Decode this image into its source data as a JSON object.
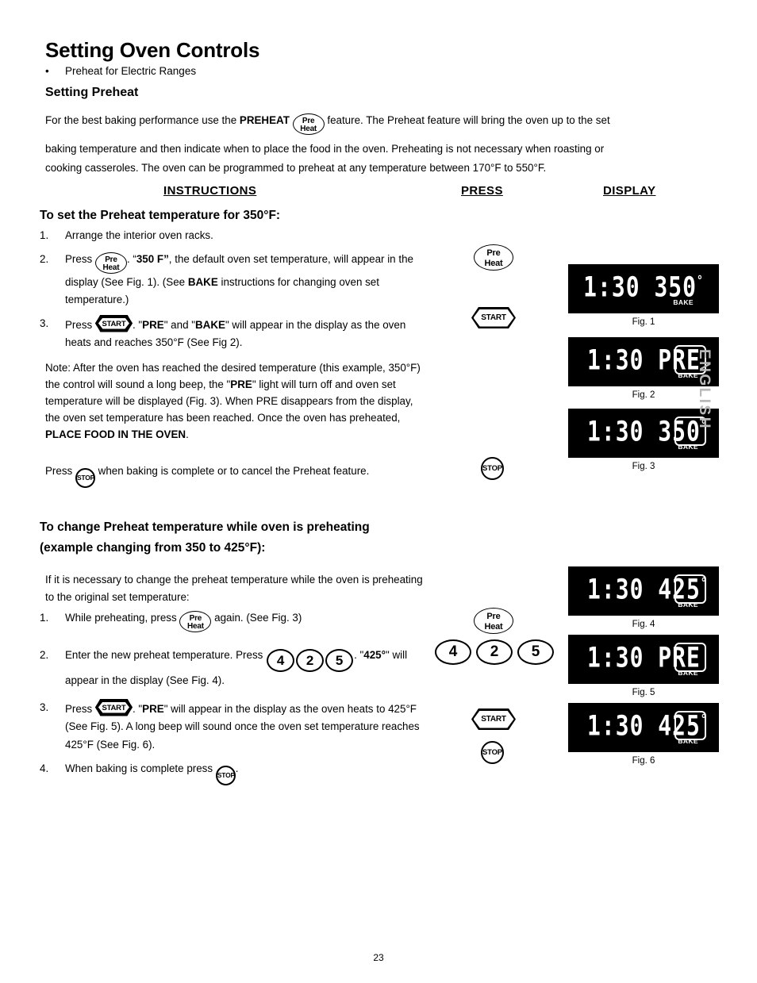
{
  "header": {
    "title": "Setting Oven Controls",
    "bullet": "Preheat for Electric Ranges",
    "subtitle": "Setting Preheat"
  },
  "intro": {
    "line1_a": "For the best baking performance use the ",
    "line1_bold": "PREHEAT",
    "line1_b": " feature. The Preheat feature will bring the oven up to the set",
    "line2": "baking temperature and then indicate when to place the food in the oven. Preheating is not necessary when roasting or",
    "line3": "cooking casseroles. The oven can be programmed to preheat at any temperature between 170°F to 550°F."
  },
  "columns": {
    "instructions": "INSTRUCTIONS",
    "press": "PRESS",
    "display": "DISPLAY"
  },
  "section1": {
    "title": "To set the Preheat temperature for 350°F:",
    "steps": [
      {
        "num": "1.",
        "text": "Arrange the interior oven racks."
      },
      {
        "num": "2.",
        "t1": "Press ",
        "t2": ". “",
        "bold1": "350 F”",
        "t3": ", the default oven set temperature, will appear in the display (See Fig. 1). (See ",
        "bold2": "BAKE",
        "t4": " instructions for changing oven set temperature.)"
      },
      {
        "num": "3.",
        "t1": "Press ",
        "t2": ". \"",
        "bold1": "PRE",
        "t3": "\" and \"",
        "bold2": "BAKE",
        "t4": "\" will appear in the display as the oven heats and reaches 350°F (See Fig 2)."
      }
    ],
    "note": {
      "a": "Note: After the oven has reached the desired temperature (this example, 350°F) the control will sound a long beep, the \"",
      "bold_pre": "PRE",
      "b": "\" light will turn off and oven set temperature will be displayed (Fig. 3). When PRE disappears from the display, the oven set temperature has been reached. Once the oven has preheated, ",
      "bold_place": "PLACE FOOD IN THE OVEN",
      "c": "."
    },
    "stop_para": {
      "a": "Press ",
      "b": " when baking is complete or to cancel the Preheat feature."
    }
  },
  "section2": {
    "title": "To change Preheat temperature while oven is preheating (example changing from 350 to 425°F):",
    "intro": "If it is necessary to change the preheat temperature while the oven is preheating to the original  set temperature:",
    "steps": [
      {
        "num": "1.",
        "t1": "While preheating, press ",
        "t2": " again.  (See Fig. 3)"
      },
      {
        "num": "2.",
        "t1": "Enter the new preheat temperature. Press ",
        "t2": ". \"",
        "bold1": "425°",
        "t3": "\"   will appear in the display (See Fig. 4)."
      },
      {
        "num": "3.",
        "t1": "Press ",
        "t2": ". \"",
        "bold1": "PRE",
        "t3": "\" will appear in the display as the oven heats to 425°F (See Fig. 5). A long beep will sound once the oven set temperature reaches 425°F  (See Fig. 6)."
      },
      {
        "num": "4.",
        "t1": "When baking is complete press ",
        "t2": "."
      }
    ]
  },
  "buttons": {
    "preheat_line1": "Pre",
    "preheat_line2": "Heat",
    "start": "START",
    "stop": "STOP",
    "digits": [
      "4",
      "2",
      "5"
    ]
  },
  "figures": [
    {
      "id": "fig1",
      "readout": "1:30 350",
      "degree": "°",
      "box": false,
      "bake": "BAKE",
      "caption": "Fig. 1"
    },
    {
      "id": "fig2",
      "readout": "1:30 PRE",
      "degree": "",
      "box": true,
      "bake": "BAKE",
      "caption": "Fig. 2"
    },
    {
      "id": "fig3",
      "readout": "1:30 350",
      "degree": "°",
      "box": true,
      "bake": "BAKE",
      "caption": "Fig. 3"
    },
    {
      "id": "fig4",
      "readout": "1:30 425",
      "degree": "°",
      "box": true,
      "bake": "BAKE",
      "caption": "Fig. 4"
    },
    {
      "id": "fig5",
      "readout": "1:30 PRE",
      "degree": "",
      "box": true,
      "bake": "BAKE",
      "caption": "Fig. 5"
    },
    {
      "id": "fig6",
      "readout": "1:30 425",
      "degree": "°",
      "box": true,
      "bake": "BAKE",
      "caption": "Fig. 6"
    }
  ],
  "side_tab": "ENGLISH",
  "page_number": "23"
}
